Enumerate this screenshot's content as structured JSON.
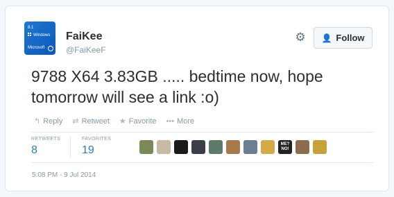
{
  "user": {
    "name": "FaiKee",
    "handle": "@FaiKeeF",
    "avatar": {
      "line1": "8.1",
      "line2": "Windows",
      "line3": "Microsoft",
      "bg": "#1f78d1"
    }
  },
  "header": {
    "gear_icon": "gear-icon",
    "follow_icon": "add-user-icon",
    "follow_label": "Follow"
  },
  "tweet": {
    "text": "9788 X64 3.83GB ..... bedtime now, hope tomorrow will see a link :o)"
  },
  "actions": [
    {
      "icon": "reply-icon",
      "glyph": "↰",
      "label": "Reply"
    },
    {
      "icon": "retweet-icon",
      "glyph": "⇄",
      "label": "Retweet"
    },
    {
      "icon": "star-icon",
      "glyph": "★",
      "label": "Favorite"
    },
    {
      "icon": "more-icon",
      "glyph": "•••",
      "label": "More"
    }
  ],
  "stats": {
    "retweets_label": "RETWEETS",
    "retweets": "8",
    "favorites_label": "FAVORITES",
    "favorites": "19"
  },
  "favoriters": [
    {
      "bg": "#7a8a55",
      "text": ""
    },
    {
      "bg": "#c9b9a6",
      "text": ""
    },
    {
      "bg": "#1a1a1a",
      "text": ""
    },
    {
      "bg": "#3a3f4a",
      "text": ""
    },
    {
      "bg": "#5e7a6a",
      "text": ""
    },
    {
      "bg": "#a8794b",
      "text": ""
    },
    {
      "bg": "#6b7e92",
      "text": ""
    },
    {
      "bg": "#d4a94a",
      "text": ""
    },
    {
      "bg": "#222222",
      "text": "ME? NO!"
    },
    {
      "bg": "#8c6b4e",
      "text": ""
    },
    {
      "bg": "#c8a13a",
      "text": ""
    }
  ],
  "timestamp": "5:08 PM - 9 Jul 2014",
  "colors": {
    "accent": "#2b7bb9",
    "text": "#292f33",
    "muted": "#8899a6"
  }
}
